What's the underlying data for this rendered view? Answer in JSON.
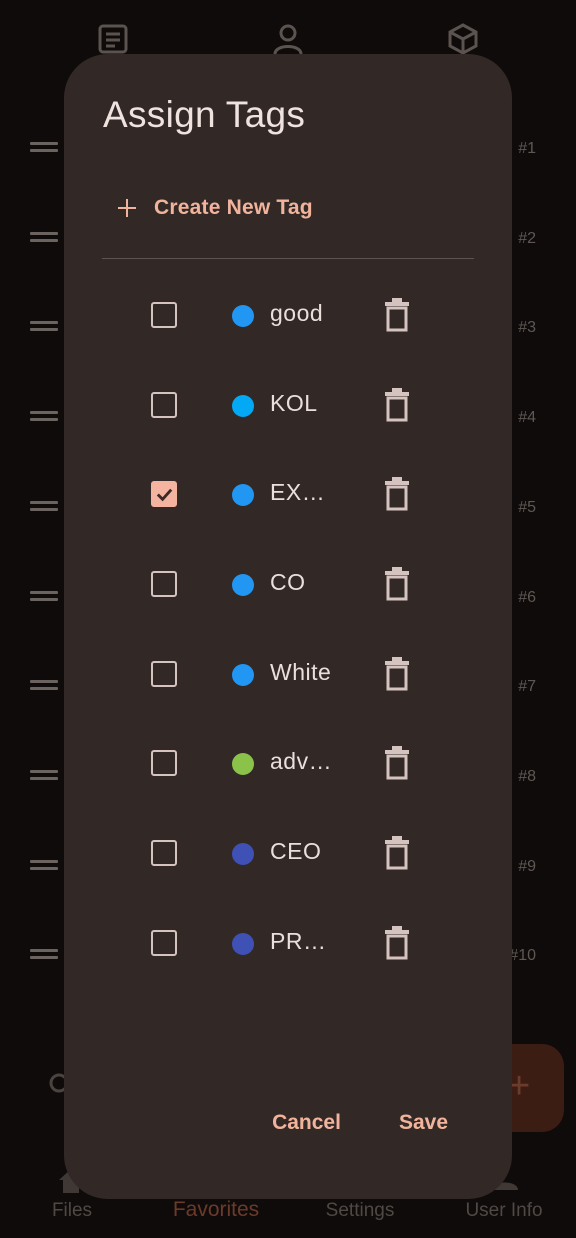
{
  "background": {
    "top_icons": [
      "document-icon",
      "person-icon",
      "cube-icon"
    ],
    "row_indices": [
      "#1",
      "#2",
      "#3",
      "#4",
      "#5",
      "#6",
      "#7",
      "#8",
      "#9",
      "#10"
    ],
    "nav": {
      "items": [
        {
          "label": "Files",
          "icon": "home-icon"
        },
        {
          "label": "Favorites",
          "icon": "star-icon",
          "active": true
        },
        {
          "label": "Settings",
          "icon": "gear-icon"
        },
        {
          "label": "User Info",
          "icon": "person-icon"
        }
      ]
    },
    "fab_label": "+"
  },
  "dialog": {
    "title": "Assign Tags",
    "create_label": "Create New Tag",
    "tags": [
      {
        "name": "good",
        "color": "#2196f3",
        "checked": false
      },
      {
        "name": "KOL",
        "color": "#03a9f4",
        "checked": false
      },
      {
        "name": "EXECUTIVE",
        "color": "#2196f3",
        "checked": true
      },
      {
        "name": "CO",
        "color": "#2196f3",
        "checked": false
      },
      {
        "name": "White",
        "color": "#2196f3",
        "checked": false
      },
      {
        "name": "advisor",
        "color": "#8bc34a",
        "checked": false
      },
      {
        "name": "CEO",
        "color": "#3f51b5",
        "checked": false
      },
      {
        "name": "PRESS",
        "color": "#3f51b5",
        "checked": false
      }
    ],
    "cancel_label": "Cancel",
    "save_label": "Save"
  },
  "colors": {
    "accent": "#f2b39c",
    "dialog_bg": "#322927",
    "app_bg": "#0f0b0a"
  }
}
